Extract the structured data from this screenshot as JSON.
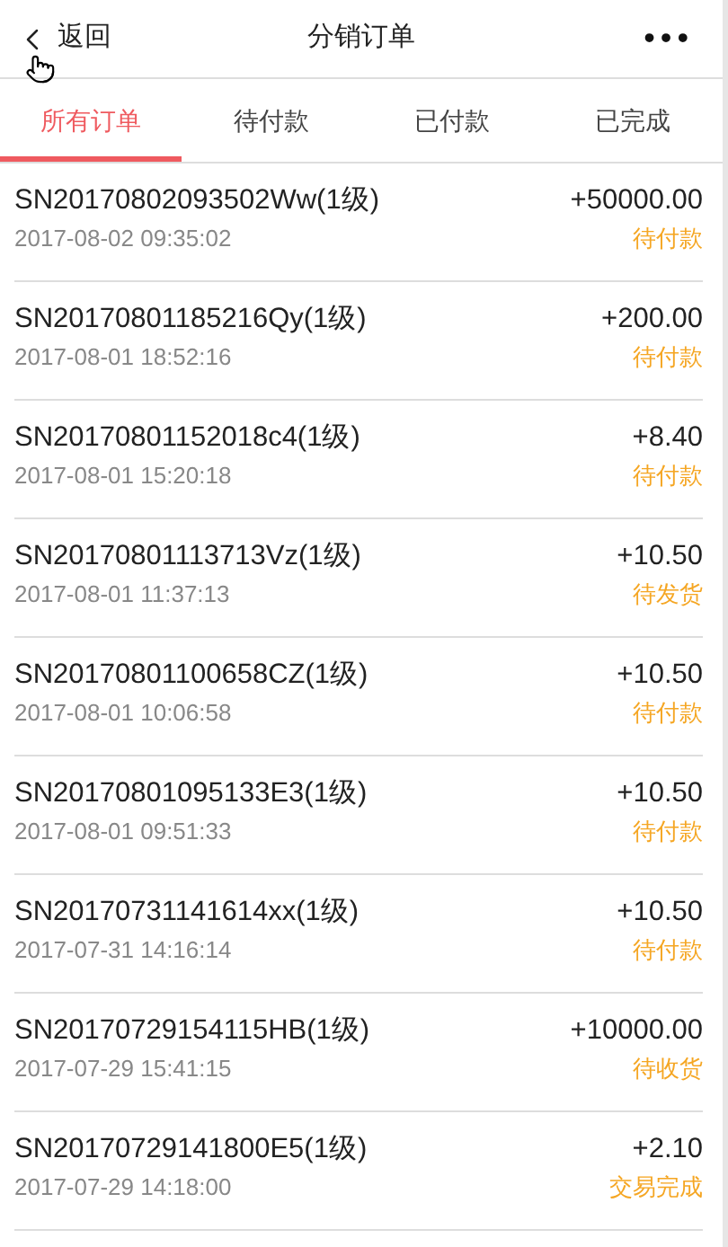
{
  "header": {
    "back": "返回",
    "title": "分销订单",
    "more": "•••"
  },
  "tabs": [
    {
      "label": "所有订单",
      "selected": true
    },
    {
      "label": "待付款",
      "selected": false
    },
    {
      "label": "已付款",
      "selected": false
    },
    {
      "label": "已完成",
      "selected": false
    }
  ],
  "orders": [
    {
      "number": "SN20170802093502Ww(1级)",
      "time": "2017-08-02 09:35:02",
      "amount": "+50000.00",
      "status": "待付款"
    },
    {
      "number": "SN20170801185216Qy(1级)",
      "time": "2017-08-01 18:52:16",
      "amount": "+200.00",
      "status": "待付款"
    },
    {
      "number": "SN20170801152018c4(1级)",
      "time": "2017-08-01 15:20:18",
      "amount": "+8.40",
      "status": "待付款"
    },
    {
      "number": "SN20170801113713Vz(1级)",
      "time": "2017-08-01 11:37:13",
      "amount": "+10.50",
      "status": "待发货"
    },
    {
      "number": "SN20170801100658CZ(1级)",
      "time": "2017-08-01 10:06:58",
      "amount": "+10.50",
      "status": "待付款"
    },
    {
      "number": "SN20170801095133E3(1级)",
      "time": "2017-08-01 09:51:33",
      "amount": "+10.50",
      "status": "待付款"
    },
    {
      "number": "SN20170731141614xx(1级)",
      "time": "2017-07-31 14:16:14",
      "amount": "+10.50",
      "status": "待付款"
    },
    {
      "number": "SN20170729154115HB(1级)",
      "time": "2017-07-29 15:41:15",
      "amount": "+10000.00",
      "status": "待收货"
    },
    {
      "number": "SN20170729141800E5(1级)",
      "time": "2017-07-29 14:18:00",
      "amount": "+2.10",
      "status": "交易完成"
    }
  ]
}
